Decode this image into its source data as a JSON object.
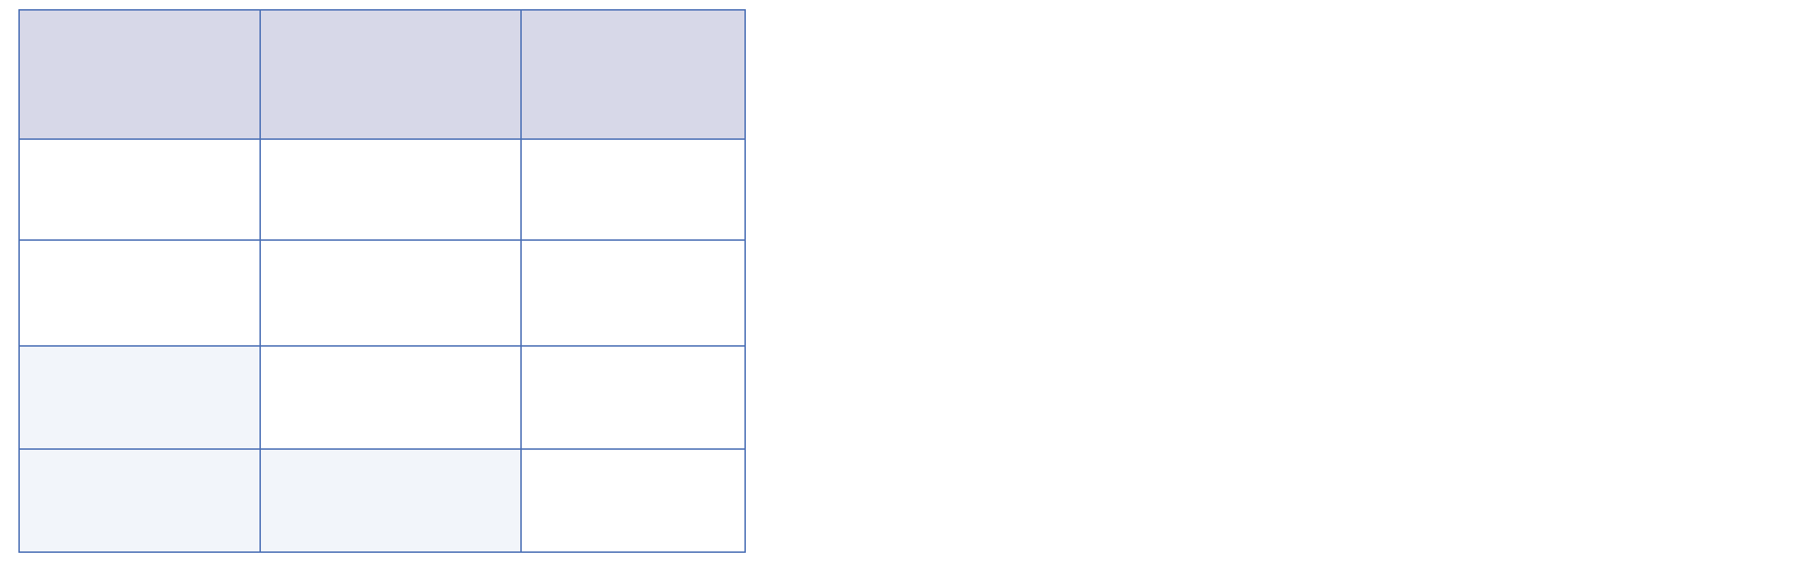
{
  "table": {
    "header": [
      "",
      "",
      ""
    ],
    "rows": [
      [
        "",
        "",
        ""
      ],
      [
        "",
        "",
        ""
      ],
      [
        "",
        "",
        ""
      ],
      [
        "",
        "",
        ""
      ]
    ],
    "colors": {
      "header_fill": "#d7d8e8",
      "shaded_fill": "#f2f5fa",
      "plain_fill": "#ffffff",
      "border": "#4a6fb5"
    }
  }
}
